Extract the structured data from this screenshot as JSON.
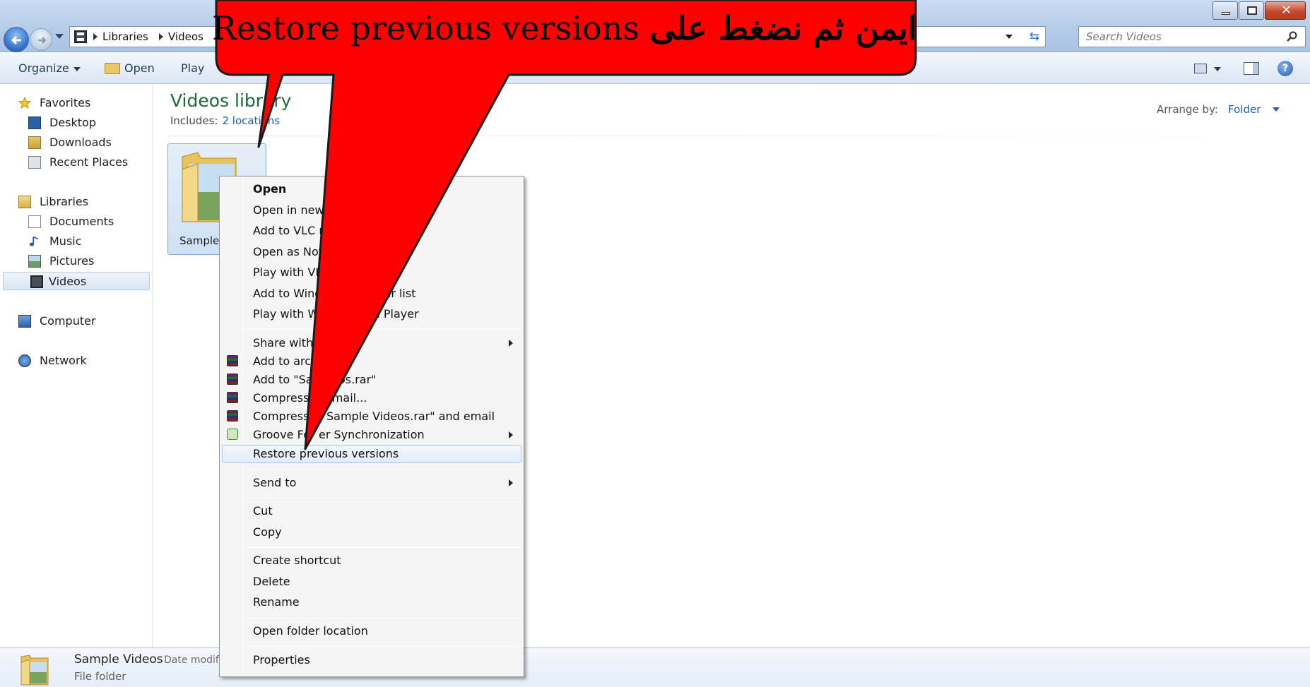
{
  "window": {
    "breadcrumb": [
      "Libraries",
      "Videos"
    ],
    "search_placeholder": "Search Videos",
    "colors": {
      "accent": "#1c5fb5",
      "callout_red": "#ff0000",
      "title_green": "#1e6b36"
    }
  },
  "toolbar": {
    "organize": "Organize",
    "open": "Open",
    "play": "Play"
  },
  "navpane": {
    "favorites": "Favorites",
    "desktop": "Desktop",
    "downloads": "Downloads",
    "recent": "Recent Places",
    "libraries": "Libraries",
    "documents": "Documents",
    "music": "Music",
    "pictures": "Pictures",
    "videos": "Videos",
    "computer": "Computer",
    "network": "Network"
  },
  "content": {
    "title": "Videos library",
    "includes_label": "Includes:",
    "includes_link": "2 locations",
    "arrange_label": "Arrange by:",
    "arrange_value": "Folder",
    "folder_label": "Sample"
  },
  "context_menu": {
    "items": [
      "Open",
      "Open in new",
      "Add to VLC n",
      "Open as Note",
      "Play with VL",
      "Add to Windo",
      "yer list",
      "Play with W",
      "a Player",
      "Share with",
      "Add to arch",
      "Add to \"Sa",
      "deos.rar\"",
      "Compress",
      "email...",
      "Compress",
      "Sample Videos.rar\" and email",
      "Groove Fo",
      "er Synchronization",
      "Restore previous versions",
      "Send to",
      "Cut",
      "Copy",
      "Create shortcut",
      "Delete",
      "Rename",
      "Open folder location",
      "Properties"
    ]
  },
  "details": {
    "name": "Sample Videos",
    "meta": "Date modif",
    "type": "File folder"
  },
  "callout": {
    "line1": "Restore previous versions",
    "line1_arabic": "ايمن ثم نضغط على"
  }
}
